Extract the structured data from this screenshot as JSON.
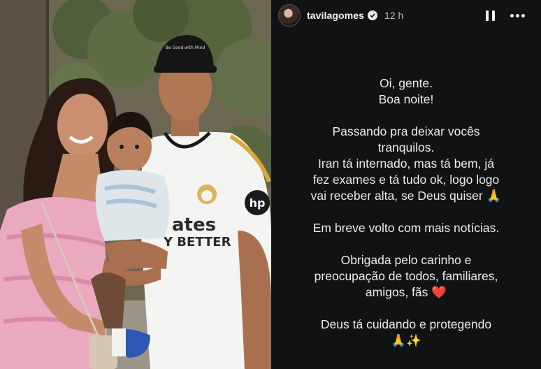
{
  "story": {
    "username": "tavilagomes",
    "timestamp": "12 h",
    "verified": true,
    "icons": {
      "pause": "pause-icon",
      "more": "more-options-icon",
      "verified": "verified-badge-icon"
    },
    "lines": [
      "Oi, gente.",
      "Boa noite!",
      "",
      "Passando pra deixar vocês",
      "tranquilos.",
      "Iran tá internado, mas tá bem, já",
      "fez exames e tá tudo ok, logo logo",
      "vai receber alta, se Deus quiser 🙏",
      "",
      "Em breve volto com mais notícias.",
      "",
      "Obrigada pelo carinho e",
      "preocupação de todos, familiares,",
      "amigos, fãs ❤️",
      "",
      "Deus tá cuidando e protegendo",
      "🙏✨"
    ]
  },
  "photo": {
    "cap_text": "Be Good with Mind",
    "jersey_text_1": "ates",
    "jersey_text_2": "Y BETTER",
    "sponsor": "hp",
    "colors": {
      "dress": "#e9a9bf",
      "jersey": "#f4f4f2",
      "jersey_trim": "#d9a93a",
      "cap": "#151515",
      "baby_shirt": "#dfe6ea"
    }
  },
  "colors": {
    "story_background": "#111214",
    "text": "#ececec"
  }
}
